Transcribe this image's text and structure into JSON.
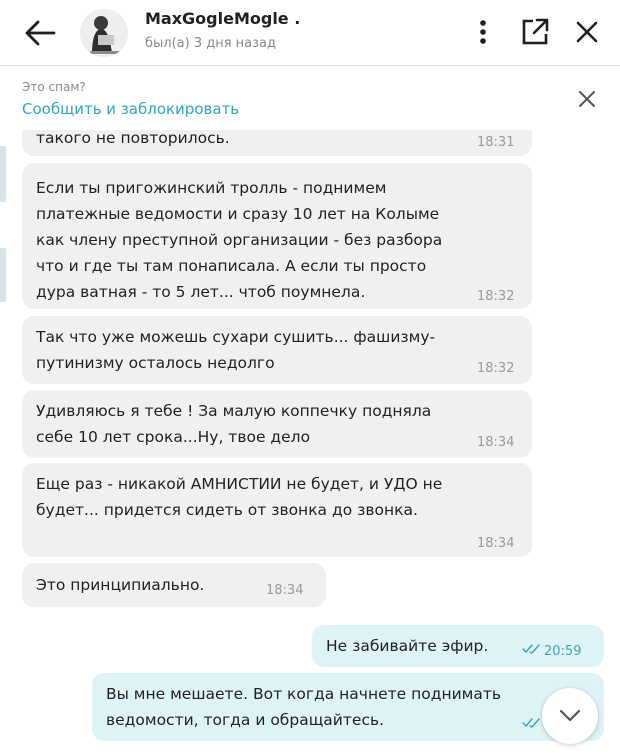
{
  "header": {
    "contact_name": "MaxGogleMogle .",
    "last_seen": "был(а) 3 дня назад",
    "icons": [
      "arrow-left-icon",
      "dots-vertical-icon",
      "open-external-icon",
      "close-icon"
    ]
  },
  "spam_bar": {
    "question": "Это спам?",
    "action": "Сообщить и заблокировать"
  },
  "colors": {
    "accent": "#2fa8b8",
    "incoming_bubble": "#f0f0f0",
    "outgoing_bubble": "#def3f5"
  },
  "messages": [
    {
      "direction": "in",
      "text": "такого не повторилось.",
      "time": "18:31"
    },
    {
      "direction": "in",
      "text": "Если ты пригожинский тролль - поднимем\nплатежные ведомости и сразу 10 лет на Колыме\nкак члену преступной организации - без разбора\nчто и где ты там понаписала. А если ты просто\nдура ватная - то 5 лет... чтоб поумнела.",
      "time": "18:32"
    },
    {
      "direction": "in",
      "text": "Так что уже можешь сухари сушить... фашизму-\nпутинизму осталось недолго",
      "time": "18:32"
    },
    {
      "direction": "in",
      "text": "Удивляюсь я тебе ! За малую коппечку подняла\nсебе 10 лет срока...Ну, твое дело",
      "time": "18:34"
    },
    {
      "direction": "in",
      "text": "Еще раз - никакой АМНИСТИИ не будет, и УДО не\nбудет... придется сидеть от звонка до звонка.",
      "time": "18:34"
    },
    {
      "direction": "in",
      "text": "Это принципиально.",
      "time": "18:34"
    },
    {
      "direction": "out",
      "text": "Не забивайте эфир.",
      "time": "20:59"
    },
    {
      "direction": "out",
      "text": "Вы мне мешаете. Вот когда начнете поднимать\nведомости, тогда и обращайтесь.",
      "time": ""
    }
  ]
}
